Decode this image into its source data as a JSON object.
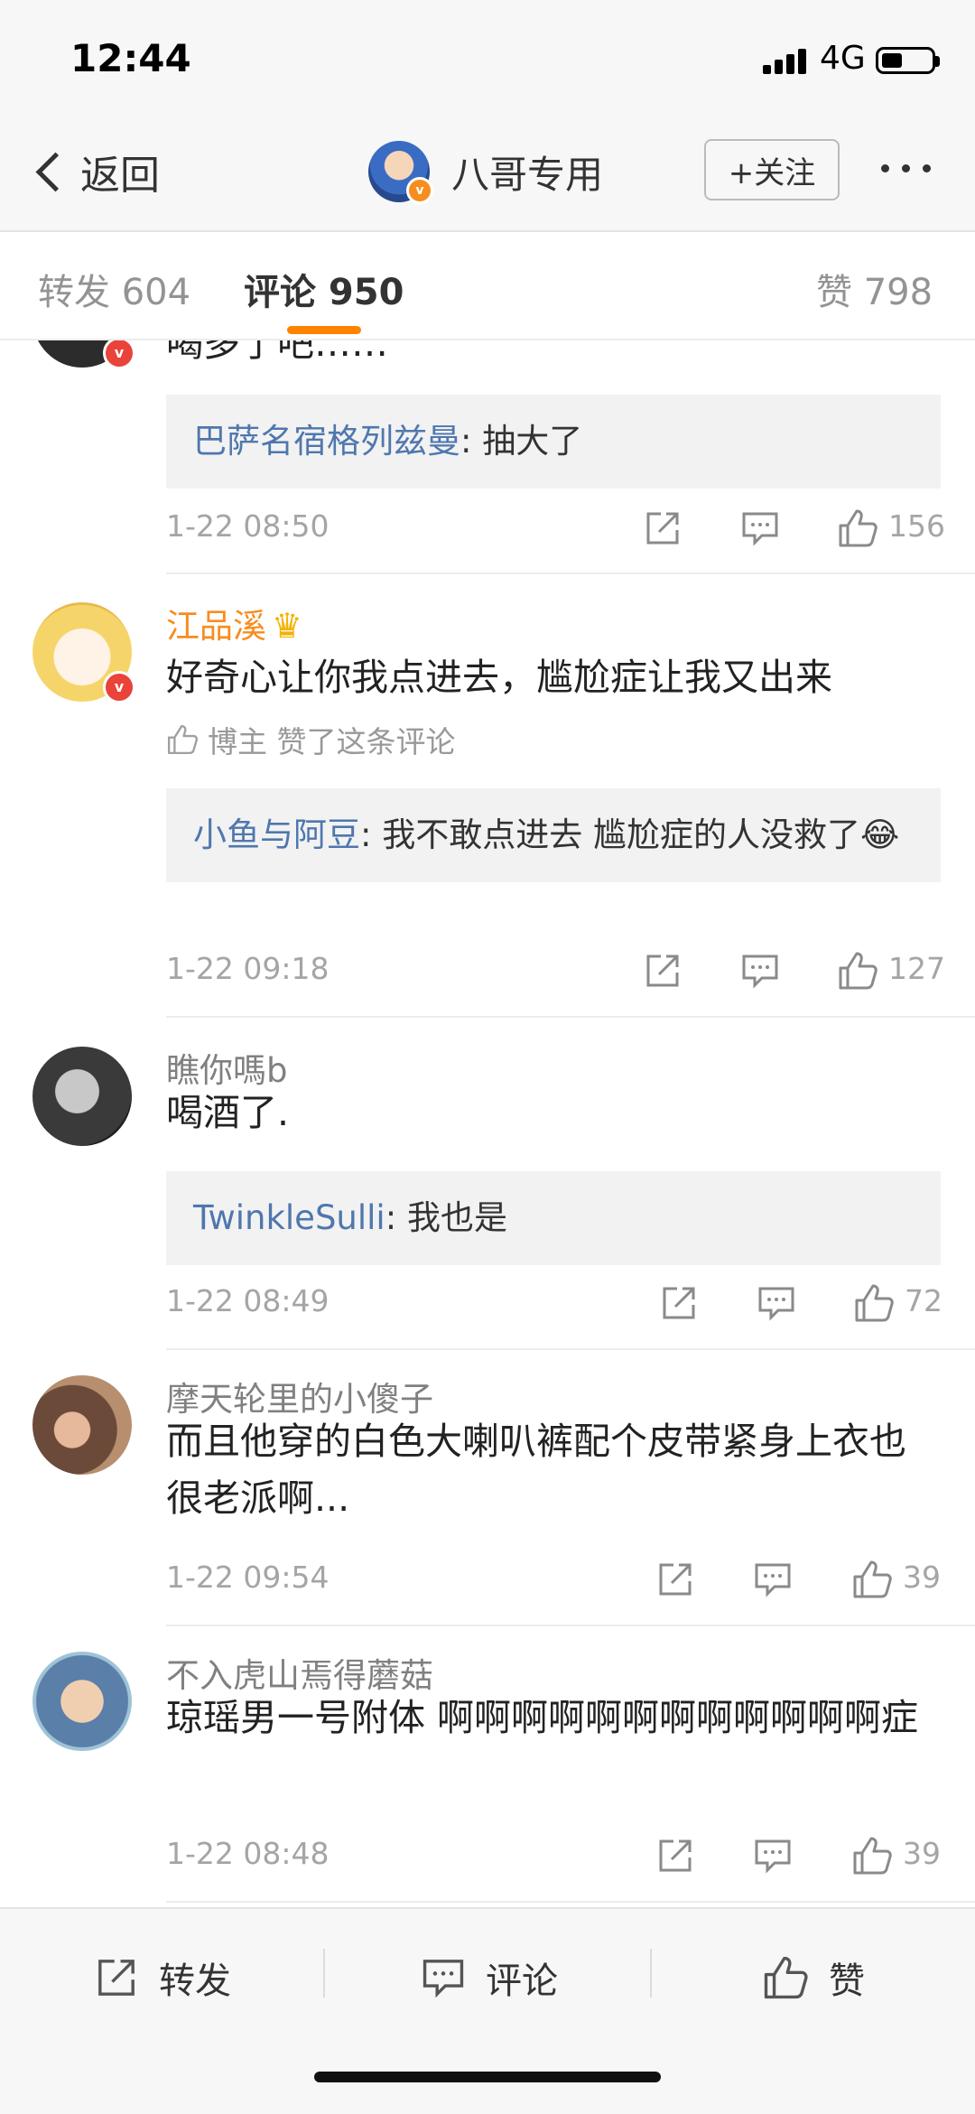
{
  "status": {
    "time": "12:44",
    "network": "4G"
  },
  "nav": {
    "back": "返回",
    "name": "八哥专用",
    "follow": "+关注"
  },
  "tabs": {
    "repost": "转发 604",
    "comment": "评论 950",
    "likes": "赞 798"
  },
  "comments": [
    {
      "user": "",
      "text": "喝多了吧……",
      "reply_user": "巴萨名宿格列兹曼",
      "reply_text": ": 抽大了",
      "time": "1-22 08:50",
      "likes": "156"
    },
    {
      "user": "江品溪",
      "text": "好奇心让你我点进去，尴尬症让我又出来",
      "liked_by": "博主 赞了这条评论",
      "reply_user": "小鱼与阿豆",
      "reply_text": ": 我不敢点进去 尴尬症的人没救了😂",
      "time": "1-22 09:18",
      "likes": "127"
    },
    {
      "user": "瞧你嗎b",
      "text": "喝酒了.",
      "reply_user": "TwinkleSulli",
      "reply_text": ": 我也是",
      "time": "1-22 08:49",
      "likes": "72"
    },
    {
      "user": "摩天轮里的小傻子",
      "text": "而且他穿的白色大喇叭裤配个皮带紧身上衣也很老派啊...",
      "time": "1-22 09:54",
      "likes": "39"
    },
    {
      "user": "不入虎山焉得蘑菇",
      "text": "琼瑶男一号附体 啊啊啊啊啊啊啊啊啊啊啊啊症",
      "time": "1-22 08:48",
      "likes": "39"
    }
  ],
  "bottom": {
    "repost": "转发",
    "comment": "评论",
    "like": "赞"
  },
  "colors": {
    "accent": "#ff8200",
    "link": "#4f77ae",
    "vip_name": "#f78d1e"
  }
}
